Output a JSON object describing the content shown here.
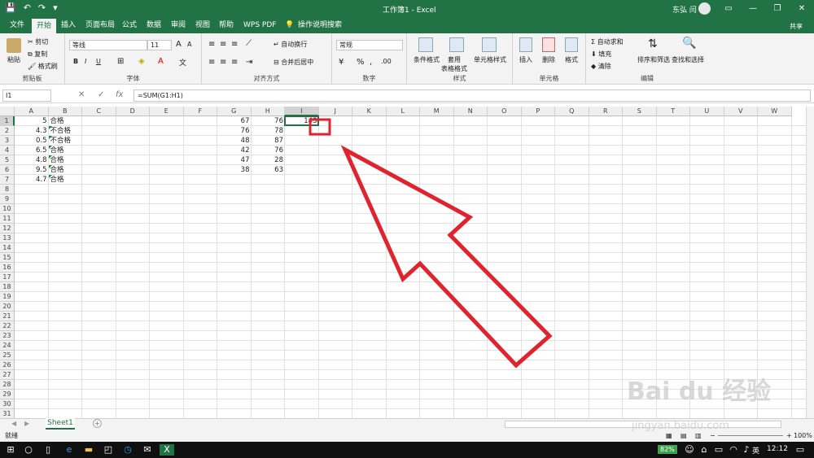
{
  "titlebar": {
    "qat": [
      "💾",
      "↶",
      "↷",
      "▾"
    ],
    "title": "工作簿1  -  Excel",
    "user": "东弘 闫",
    "win": [
      "▭",
      "—",
      "❐",
      "✕"
    ]
  },
  "tabs": [
    {
      "label": "文件"
    },
    {
      "label": "开始"
    },
    {
      "label": "插入"
    },
    {
      "label": "页面布局"
    },
    {
      "label": "公式"
    },
    {
      "label": "数据"
    },
    {
      "label": "审阅"
    },
    {
      "label": "视图"
    },
    {
      "label": "帮助"
    },
    {
      "label": "WPS PDF"
    },
    {
      "label": "操作说明搜索"
    }
  ],
  "share": "共享",
  "ribbon": {
    "clipboard": {
      "paste": "粘贴",
      "cut": "剪切",
      "copy": "复制",
      "painter": "格式刷",
      "label": "剪贴板"
    },
    "font": {
      "name": "等线",
      "size": "11",
      "bold": "B",
      "italic": "I",
      "underline": "U",
      "grow": "A",
      "shrink": "A",
      "label": "字体"
    },
    "alignment": {
      "wrap": "自动换行",
      "merge": "合并后居中",
      "label": "对齐方式"
    },
    "number": {
      "format": "常规",
      "percent": "%",
      "comma": ",",
      "label": "数字"
    },
    "styles": {
      "cond": "条件格式",
      "table": "套用\n表格格式",
      "cell": "单元格样式",
      "label": "样式"
    },
    "cells": {
      "insert": "插入",
      "delete": "删除",
      "format": "格式",
      "label": "单元格"
    },
    "editing": {
      "autosum": "自动求和",
      "fill": "填充",
      "clear": "清除",
      "sort": "排序和筛选",
      "find": "查找和选择",
      "label": "编辑"
    }
  },
  "formula_bar": {
    "namebox": "I1",
    "cancel": "✕",
    "enter": "✓",
    "fx": "fx",
    "formula": "=SUM(G1:H1)"
  },
  "columns": [
    "A",
    "B",
    "C",
    "D",
    "E",
    "F",
    "G",
    "H",
    "I",
    "J",
    "K",
    "L",
    "M",
    "N",
    "O",
    "P",
    "Q",
    "R",
    "S",
    "T",
    "U",
    "V",
    "W"
  ],
  "rows": [
    "1",
    "2",
    "3",
    "4",
    "5",
    "6",
    "7",
    "8",
    "9",
    "10",
    "11",
    "12",
    "13",
    "14",
    "15",
    "16",
    "17",
    "18",
    "19",
    "20",
    "21",
    "22",
    "23",
    "24",
    "25",
    "26",
    "27",
    "28",
    "29",
    "30",
    "31"
  ],
  "cells": {
    "A": [
      "5",
      "4.3",
      "0.5",
      "6.5",
      "4.8",
      "9.5",
      "4.7"
    ],
    "B": [
      "合格",
      "不合格",
      "不合格",
      "合格",
      "合格",
      "合格",
      "合格"
    ],
    "G": [
      "67",
      "76",
      "48",
      "42",
      "47",
      "38"
    ],
    "H": [
      "76",
      "78",
      "87",
      "76",
      "28",
      "63"
    ],
    "I1": "143"
  },
  "sheet": {
    "tab": "Sheet1",
    "add": "+"
  },
  "status": {
    "ready": "就绪",
    "zoom": "100%"
  },
  "taskbar": {
    "battery": "82%",
    "ime": "英",
    "time": "12:12"
  },
  "watermark": {
    "brand": "Bai du 经验",
    "url": "jingyan.baidu.com"
  },
  "colors": {
    "excel_green": "#217346",
    "callout_red": "#e0232e"
  }
}
